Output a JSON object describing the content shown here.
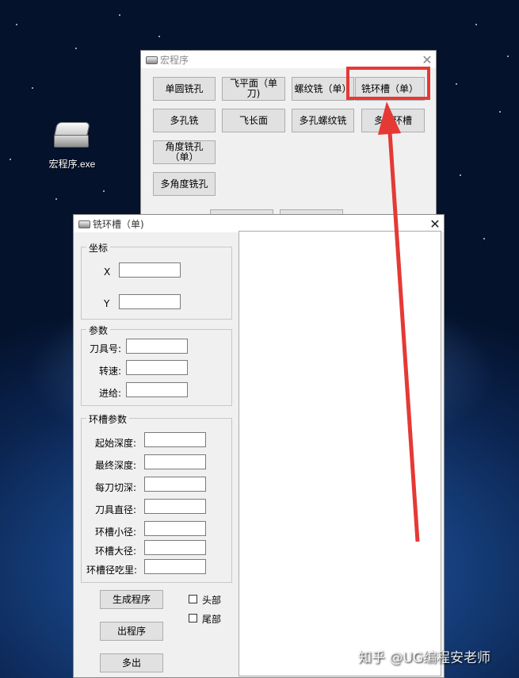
{
  "desktop": {
    "icon_label": "宏程序.exe",
    "watermark": "知乎 @UG编程安老师"
  },
  "back_window": {
    "title": "宏程序",
    "buttons": [
      "单圆铣孔",
      "飞平面（单刀)",
      "螺纹铣（单）",
      "铣环槽（单）",
      "多孔铣",
      "飞长面",
      "多孔螺纹铣",
      "多铣环槽",
      "角度铣孔（单）",
      "多角度铣孔"
    ]
  },
  "front_window": {
    "title": "铣环槽（单)",
    "coord_group": {
      "title": "坐标",
      "x_label": "X",
      "y_label": "Y",
      "x_value": "",
      "y_value": ""
    },
    "param_group": {
      "title": "参数",
      "fields": [
        {
          "label": "刀具号:",
          "value": ""
        },
        {
          "label": "转速:",
          "value": ""
        },
        {
          "label": "进给:",
          "value": ""
        }
      ]
    },
    "groove_group": {
      "title": "环槽参数",
      "fields": [
        {
          "label": "起始深度:",
          "value": ""
        },
        {
          "label": "最终深度:",
          "value": ""
        },
        {
          "label": "每刀切深:",
          "value": ""
        },
        {
          "label": "刀具直径:",
          "value": ""
        },
        {
          "label": "环槽小径:",
          "value": ""
        },
        {
          "label": "环槽大径:",
          "value": ""
        },
        {
          "label": "环槽径吃里:",
          "value": ""
        }
      ]
    },
    "buttons": {
      "generate": "生成程序",
      "output": "出程序",
      "multi_output": "多出"
    },
    "checkboxes": {
      "head": {
        "label": "头部",
        "checked": false
      },
      "tail": {
        "label": "尾部",
        "checked": false
      }
    },
    "output_text": ""
  },
  "annotation": {
    "highlight_color": "#e53935",
    "highlight_target": "铣环槽（单）"
  }
}
